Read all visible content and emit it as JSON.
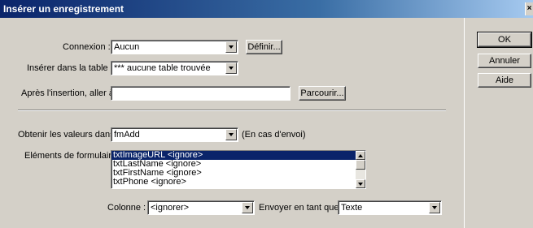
{
  "window": {
    "title": "Insérer un enregistrement",
    "close_glyph": "×"
  },
  "connexion": {
    "label": "Connexion :",
    "value": "Aucun",
    "define_button": "Définir..."
  },
  "table": {
    "label": "Insérer dans la table :",
    "value": "*** aucune table trouvée"
  },
  "after_insert": {
    "label": "Après l'insertion, aller à :",
    "value": "",
    "browse_button": "Parcourir..."
  },
  "values_from": {
    "label": "Obtenir les valeurs dans :",
    "value": "fmAdd",
    "note": "(En cas d'envoi)"
  },
  "form_elements": {
    "label": "Eléments de formulaire :",
    "items": [
      "txtImageURL <ignore>",
      "txtLastName <ignore>",
      "txtFirstName <ignore>",
      "txtPhone <ignore>"
    ]
  },
  "column": {
    "label": "Colonne :",
    "value": "<ignorer>"
  },
  "send_as": {
    "label": "Envoyer en tant que :",
    "value": "Texte"
  },
  "buttons": {
    "ok": "OK",
    "cancel": "Annuler",
    "help": "Aide"
  }
}
